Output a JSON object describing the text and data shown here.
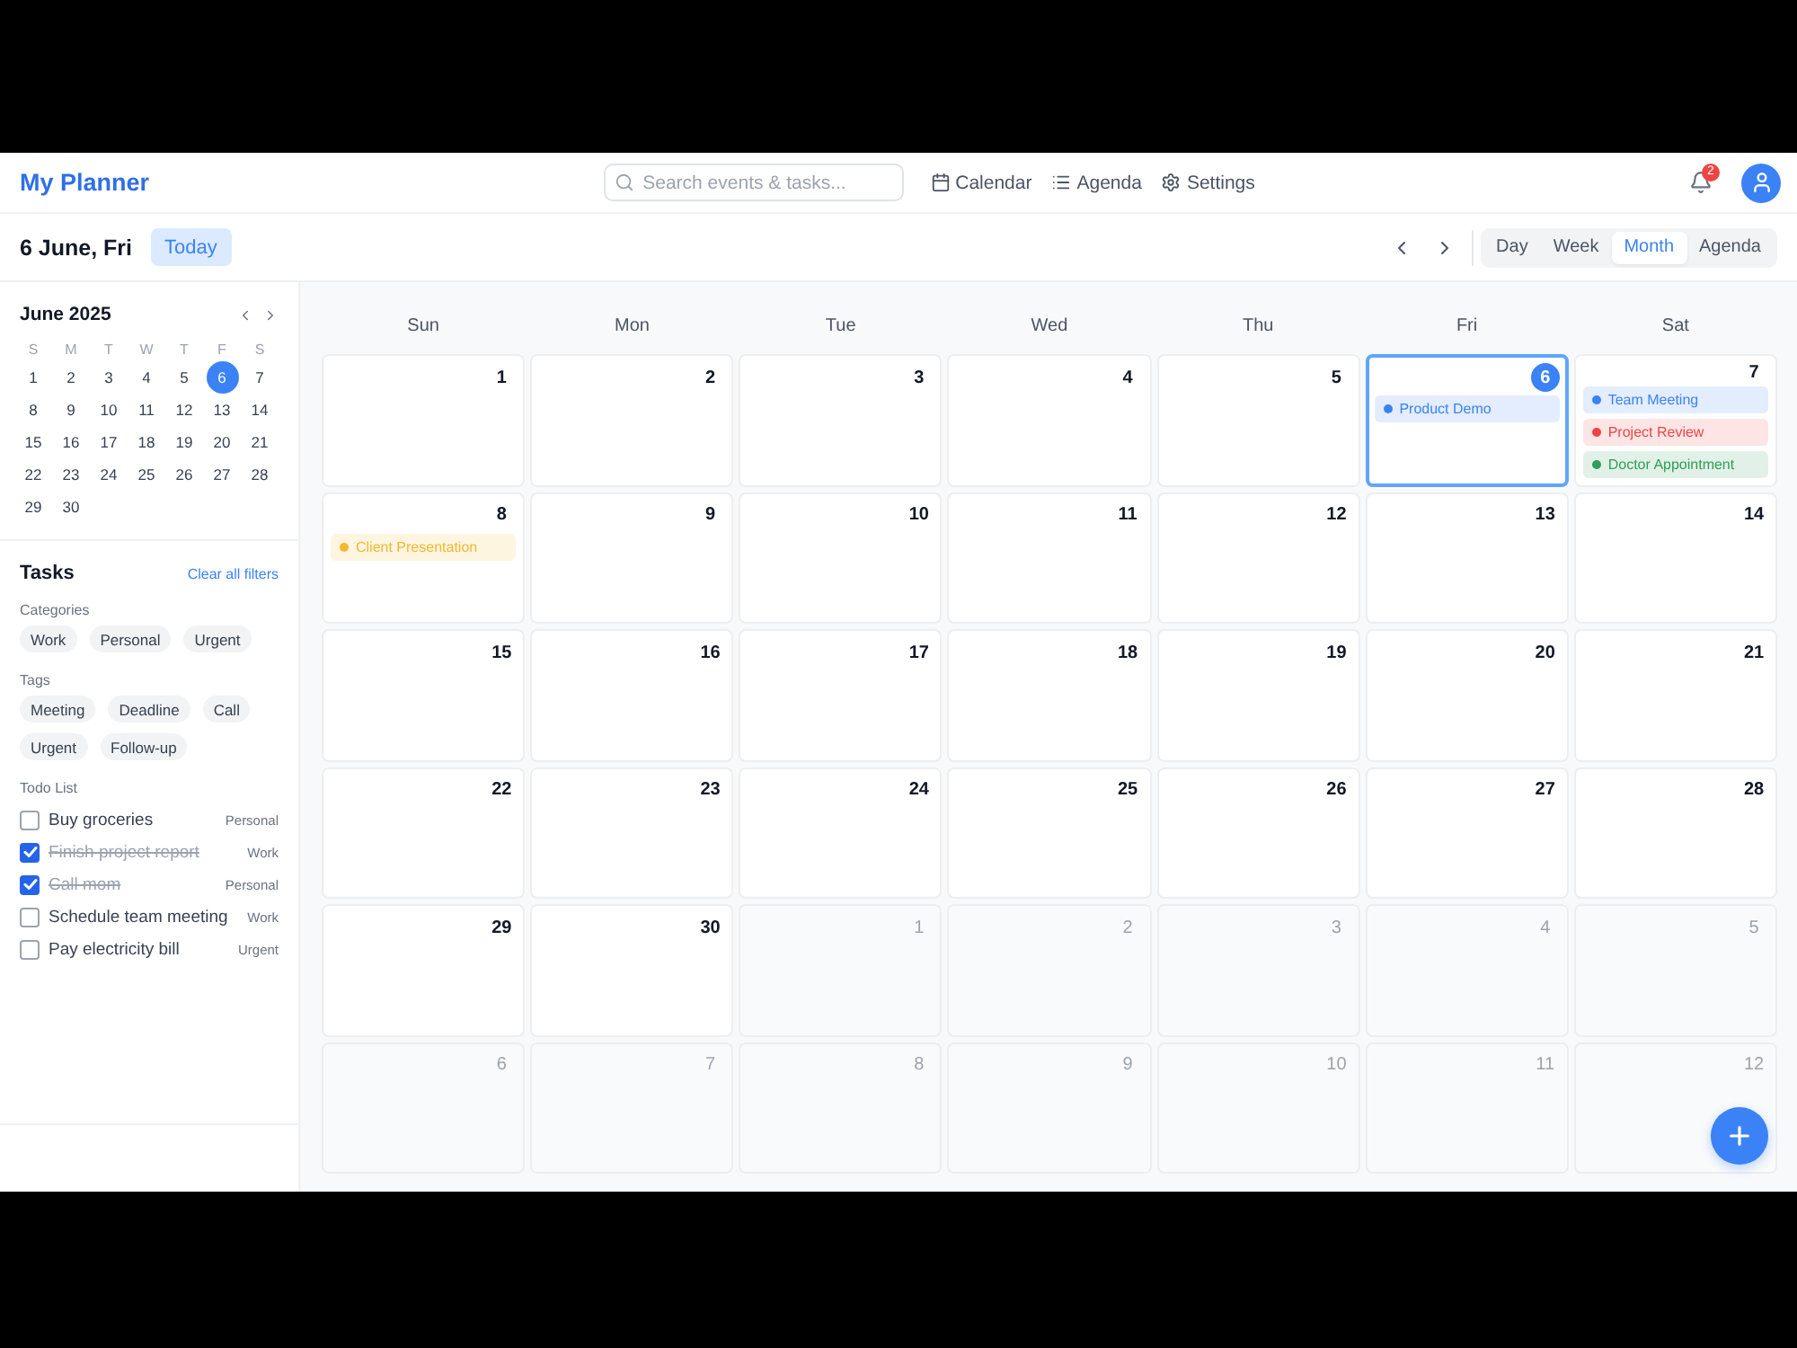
{
  "app": {
    "title": "My Planner"
  },
  "search": {
    "placeholder": "Search events & tasks..."
  },
  "nav": [
    {
      "label": "Calendar",
      "kind": "calendar"
    },
    {
      "label": "Agenda",
      "kind": "list"
    },
    {
      "label": "Settings",
      "kind": "gear"
    }
  ],
  "notifications": {
    "count": "2"
  },
  "toolbar": {
    "date": "6 June, Fri",
    "today_button": "Today",
    "views": [
      {
        "label": "Day",
        "selected": false
      },
      {
        "label": "Week",
        "selected": false
      },
      {
        "label": "Month",
        "selected": true
      },
      {
        "label": "Agenda",
        "selected": false
      }
    ]
  },
  "mini_calendar": {
    "title": "June 2025",
    "weekdays": [
      "S",
      "M",
      "T",
      "W",
      "T",
      "F",
      "S"
    ],
    "days": [
      {
        "label": "1",
        "selected": false
      },
      {
        "label": "2",
        "selected": false
      },
      {
        "label": "3",
        "selected": false
      },
      {
        "label": "4",
        "selected": false
      },
      {
        "label": "5",
        "selected": false
      },
      {
        "label": "6",
        "selected": true
      },
      {
        "label": "7",
        "selected": false
      },
      {
        "label": "8",
        "selected": false
      },
      {
        "label": "9",
        "selected": false
      },
      {
        "label": "10",
        "selected": false
      },
      {
        "label": "11",
        "selected": false
      },
      {
        "label": "12",
        "selected": false
      },
      {
        "label": "13",
        "selected": false
      },
      {
        "label": "14",
        "selected": false
      },
      {
        "label": "15",
        "selected": false
      },
      {
        "label": "16",
        "selected": false
      },
      {
        "label": "17",
        "selected": false
      },
      {
        "label": "18",
        "selected": false
      },
      {
        "label": "19",
        "selected": false
      },
      {
        "label": "20",
        "selected": false
      },
      {
        "label": "21",
        "selected": false
      },
      {
        "label": "22",
        "selected": false
      },
      {
        "label": "23",
        "selected": false
      },
      {
        "label": "24",
        "selected": false
      },
      {
        "label": "25",
        "selected": false
      },
      {
        "label": "26",
        "selected": false
      },
      {
        "label": "27",
        "selected": false
      },
      {
        "label": "28",
        "selected": false
      },
      {
        "label": "29",
        "selected": false
      },
      {
        "label": "30",
        "selected": false
      }
    ]
  },
  "tasks": {
    "title": "Tasks",
    "clear_filters": "Clear all filters",
    "categories": {
      "label": "Categories",
      "chips": [
        "Work",
        "Personal",
        "Urgent"
      ]
    },
    "tags": {
      "label": "Tags",
      "chips": [
        "Meeting",
        "Deadline",
        "Call",
        "Urgent",
        "Follow-up"
      ]
    },
    "todo": {
      "label": "Todo List",
      "items": [
        {
          "text": "Buy groceries",
          "category": "Personal",
          "checked": false
        },
        {
          "text": "Finish project report",
          "category": "Work",
          "checked": true
        },
        {
          "text": "Call mom",
          "category": "Personal",
          "checked": true
        },
        {
          "text": "Schedule team meeting",
          "category": "Work",
          "checked": false
        },
        {
          "text": "Pay electricity bill",
          "category": "Urgent",
          "checked": false
        }
      ]
    }
  },
  "calendar": {
    "weekdays": [
      "Sun",
      "Mon",
      "Tue",
      "Wed",
      "Thu",
      "Fri",
      "Sat"
    ],
    "weeks": [
      [
        {
          "day": "1",
          "outside_month": false,
          "selected": false
        },
        {
          "day": "2",
          "outside_month": false,
          "selected": false
        },
        {
          "day": "3",
          "outside_month": false,
          "selected": false
        },
        {
          "day": "4",
          "outside_month": false,
          "selected": false
        },
        {
          "day": "5",
          "outside_month": false,
          "selected": false
        },
        {
          "day": "6",
          "outside_month": false,
          "selected": true,
          "events": [
            {
              "title": "Product Demo",
              "color": "#3b82f6"
            }
          ]
        },
        {
          "day": "7",
          "outside_month": false,
          "selected": false,
          "events": [
            {
              "title": "Team Meeting",
              "color": "#3b82f6"
            },
            {
              "title": "Project Review",
              "color": "#ef4444"
            },
            {
              "title": "Doctor Appointment",
              "color": "#2f9e58"
            }
          ]
        }
      ],
      [
        {
          "day": "8",
          "outside_month": false,
          "selected": false,
          "events": [
            {
              "title": "Client Presentation",
              "color": "#f5b82e"
            }
          ]
        },
        {
          "day": "9",
          "outside_month": false,
          "selected": false
        },
        {
          "day": "10",
          "outside_month": false,
          "selected": false
        },
        {
          "day": "11",
          "outside_month": false,
          "selected": false
        },
        {
          "day": "12",
          "outside_month": false,
          "selected": false
        },
        {
          "day": "13",
          "outside_month": false,
          "selected": false
        },
        {
          "day": "14",
          "outside_month": false,
          "selected": false
        }
      ],
      [
        {
          "day": "15",
          "outside_month": false,
          "selected": false
        },
        {
          "day": "16",
          "outside_month": false,
          "selected": false
        },
        {
          "day": "17",
          "outside_month": false,
          "selected": false
        },
        {
          "day": "18",
          "outside_month": false,
          "selected": false
        },
        {
          "day": "19",
          "outside_month": false,
          "selected": false
        },
        {
          "day": "20",
          "outside_month": false,
          "selected": false
        },
        {
          "day": "21",
          "outside_month": false,
          "selected": false
        }
      ],
      [
        {
          "day": "22",
          "outside_month": false,
          "selected": false
        },
        {
          "day": "23",
          "outside_month": false,
          "selected": false
        },
        {
          "day": "24",
          "outside_month": false,
          "selected": false
        },
        {
          "day": "25",
          "outside_month": false,
          "selected": false
        },
        {
          "day": "26",
          "outside_month": false,
          "selected": false
        },
        {
          "day": "27",
          "outside_month": false,
          "selected": false
        },
        {
          "day": "28",
          "outside_month": false,
          "selected": false
        }
      ],
      [
        {
          "day": "29",
          "outside_month": false,
          "selected": false
        },
        {
          "day": "30",
          "outside_month": false,
          "selected": false
        },
        {
          "day": "1",
          "outside_month": true,
          "selected": false
        },
        {
          "day": "2",
          "outside_month": true,
          "selected": false
        },
        {
          "day": "3",
          "outside_month": true,
          "selected": false
        },
        {
          "day": "4",
          "outside_month": true,
          "selected": false
        },
        {
          "day": "5",
          "outside_month": true,
          "selected": false
        }
      ],
      [
        {
          "day": "6",
          "outside_month": true,
          "selected": false
        },
        {
          "day": "7",
          "outside_month": true,
          "selected": false
        },
        {
          "day": "8",
          "outside_month": true,
          "selected": false
        },
        {
          "day": "9",
          "outside_month": true,
          "selected": false
        },
        {
          "day": "10",
          "outside_month": true,
          "selected": false
        },
        {
          "day": "11",
          "outside_month": true,
          "selected": false
        },
        {
          "day": "12",
          "outside_month": true,
          "selected": false
        }
      ]
    ]
  }
}
